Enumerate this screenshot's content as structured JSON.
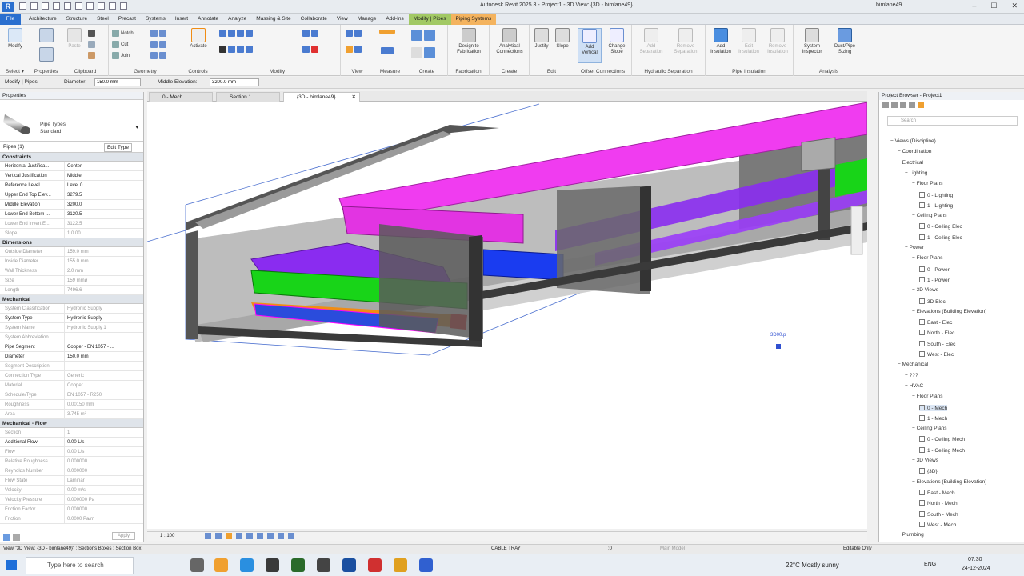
{
  "window": {
    "title": "Autodesk Revit 2025.3 - Project1 - 3D View: {3D - bimlane49}",
    "user": "bimlane49",
    "controls": [
      "–",
      "☐",
      "✕"
    ]
  },
  "menu": {
    "tabs": [
      "File",
      "Architecture",
      "Structure",
      "Steel",
      "Precast",
      "Systems",
      "Insert",
      "Annotate",
      "Analyze",
      "Massing & Site",
      "Collaborate",
      "View",
      "Manage",
      "Add-Ins",
      "Modify | Pipes",
      "Piping Systems"
    ]
  },
  "ribbon": {
    "groups": [
      "Select",
      "Properties",
      "Clipboard",
      "Geometry",
      "Controls",
      "Modify",
      "View",
      "Measure",
      "Create",
      "Fabrication",
      "Create",
      "Edit",
      "Offset Connections",
      "Hydraulic Separation",
      "Pipe Insulation",
      "Analysis"
    ],
    "buttons": {
      "modify": "Modify",
      "paste": "Paste",
      "activate": "Activate",
      "design_to_fab": "Design to Fabrication",
      "analytical": "Analytical Connections",
      "justify": "Justify",
      "slope": "Slope",
      "add_vertical": "Add Vertical",
      "change_slope": "Change Slope",
      "add_sep": "Add Separation",
      "remove_sep": "Remove Separation",
      "add_ins": "Add Insulation",
      "edit_ins": "Edit Insulation",
      "remove_ins": "Remove Insulation",
      "sys_inspector": "System Inspector",
      "duct_sizing": "Duct/Pipe Sizing"
    },
    "small": {
      "notch": "Notch",
      "cut": "Cut",
      "join": "Join"
    },
    "select_label": "Select ▾"
  },
  "options": {
    "context": "Modify | Pipes",
    "diameter_label": "Diameter:",
    "diameter": "150.0 mm",
    "elev_label": "Middle Elevation:",
    "elev": "3200.0 mm"
  },
  "properties": {
    "title": "Properties",
    "type_family": "Pipe Types",
    "type_name": "Standard",
    "instance": "Pipes (1)",
    "edit_type": "Edit Type",
    "sections": [
      {
        "name": "Constraints",
        "rows": [
          [
            "Horizontal Justifica...",
            "Center",
            0
          ],
          [
            "Vertical Justification",
            "Middle",
            0
          ],
          [
            "Reference Level",
            "Level 0",
            0
          ],
          [
            "Upper End Top Elev...",
            "3279.5",
            0
          ],
          [
            "Middle Elevation",
            "3200.0",
            0
          ],
          [
            "Lower End Bottom ...",
            "3120.5",
            0
          ],
          [
            "Lower End Invert El...",
            "3122.5",
            1
          ],
          [
            "Slope",
            "1.0.00",
            1
          ]
        ]
      },
      {
        "name": "Dimensions",
        "rows": [
          [
            "Outside Diameter",
            "159.0 mm",
            1
          ],
          [
            "Inside Diameter",
            "155.0 mm",
            1
          ],
          [
            "Wall Thickness",
            "2.0 mm",
            1
          ],
          [
            "Size",
            "159 mmø",
            1
          ],
          [
            "Length",
            "7496.6",
            1
          ]
        ]
      },
      {
        "name": "Mechanical",
        "rows": [
          [
            "System Classification",
            "Hydronic Supply",
            1
          ],
          [
            "System Type",
            "Hydronic Supply",
            0
          ],
          [
            "System Name",
            "Hydronic Supply 1",
            1
          ],
          [
            "System Abbreviation",
            "",
            1
          ],
          [
            "Pipe Segment",
            "Copper - EN 1057 - ...",
            0
          ],
          [
            "Diameter",
            "150.0 mm",
            0
          ],
          [
            "Segment Description",
            "",
            1
          ],
          [
            "Connection Type",
            "Generic",
            1
          ],
          [
            "Material",
            "Copper",
            1
          ],
          [
            "Schedule/Type",
            "EN 1057 - R250",
            1
          ],
          [
            "Roughness",
            "0.00150 mm",
            1
          ],
          [
            "Area",
            "3.745 m²",
            1
          ]
        ]
      },
      {
        "name": "Mechanical - Flow",
        "rows": [
          [
            "Section",
            "1",
            1
          ],
          [
            "Additional Flow",
            "0.00 L/s",
            0
          ],
          [
            "Flow",
            "0.00 L/s",
            1
          ],
          [
            "Relative Roughness",
            "0.000000",
            1
          ],
          [
            "Reynolds Number",
            "0.000000",
            1
          ],
          [
            "Flow State",
            "Laminar",
            1
          ],
          [
            "Velocity",
            "0.00 m/s",
            1
          ],
          [
            "Velocity Pressure",
            "0.000000 Pa",
            1
          ],
          [
            "Friction Factor",
            "0.000000",
            1
          ],
          [
            "Friction",
            "0.0000 Pa/m",
            1
          ]
        ]
      }
    ],
    "apply": "Apply"
  },
  "tabs": [
    {
      "label": "0 - Mech",
      "active": false
    },
    {
      "label": "Section 1",
      "active": false
    },
    {
      "label": "{3D - bimlane49}",
      "active": true
    }
  ],
  "viewport": {
    "tag": "3D00.p",
    "viewbar_scale": "1 : 100"
  },
  "browser": {
    "title": "Project Browser - Project1",
    "search": "Search",
    "nodes": [
      [
        "Views (Discipline)",
        0,
        0,
        0
      ],
      [
        "Coordination",
        1,
        0,
        0
      ],
      [
        "Electrical",
        1,
        0,
        0
      ],
      [
        "Lighting",
        2,
        0,
        0
      ],
      [
        "Floor Plans",
        3,
        0,
        0
      ],
      [
        "0 - Lighting",
        4,
        1,
        0
      ],
      [
        "1 - Lighting",
        4,
        1,
        0
      ],
      [
        "Ceiling Plans",
        3,
        0,
        0
      ],
      [
        "0 - Ceiling Elec",
        4,
        1,
        0
      ],
      [
        "1 - Ceiling Elec",
        4,
        1,
        0
      ],
      [
        "Power",
        2,
        0,
        0
      ],
      [
        "Floor Plans",
        3,
        0,
        0
      ],
      [
        "0 - Power",
        4,
        1,
        0
      ],
      [
        "1 - Power",
        4,
        1,
        0
      ],
      [
        "3D Views",
        3,
        0,
        0
      ],
      [
        "3D Elec",
        4,
        1,
        0
      ],
      [
        "Elevations (Building Elevation)",
        3,
        0,
        0
      ],
      [
        "East - Elec",
        4,
        1,
        0
      ],
      [
        "North - Elec",
        4,
        1,
        0
      ],
      [
        "South - Elec",
        4,
        1,
        0
      ],
      [
        "West - Elec",
        4,
        1,
        0
      ],
      [
        "Mechanical",
        1,
        0,
        0
      ],
      [
        "???",
        2,
        0,
        0
      ],
      [
        "HVAC",
        2,
        0,
        0
      ],
      [
        "Floor Plans",
        3,
        0,
        0
      ],
      [
        "0 - Mech",
        4,
        1,
        1
      ],
      [
        "1 - Mech",
        4,
        1,
        0
      ],
      [
        "Ceiling Plans",
        3,
        0,
        0
      ],
      [
        "0 - Ceiling Mech",
        4,
        1,
        0
      ],
      [
        "1 - Ceiling Mech",
        4,
        1,
        0
      ],
      [
        "3D Views",
        3,
        0,
        0
      ],
      [
        "{3D}",
        4,
        1,
        0
      ],
      [
        "Elevations (Building Elevation)",
        3,
        0,
        0
      ],
      [
        "East - Mech",
        4,
        1,
        0
      ],
      [
        "North - Mech",
        4,
        1,
        0
      ],
      [
        "South - Mech",
        4,
        1,
        0
      ],
      [
        "West - Mech",
        4,
        1,
        0
      ],
      [
        "Plumbing",
        1,
        0,
        0
      ]
    ]
  },
  "status": {
    "left": "View \"3D View: {3D - bimlane49}\" : Sections Boxes : Section Box",
    "mid": "CABLE TRAY",
    "zero": ":0",
    "model": "Main Model",
    "editable": "Editable Only"
  },
  "taskbar": {
    "search": "Type here to search",
    "weather": "22°C  Mostly sunny",
    "lang": "ENG",
    "time": "07:30",
    "date": "24-12-2024"
  },
  "colors": {
    "magenta": "#f03cf0",
    "purple": "#8a2cf0",
    "green": "#18d418",
    "blue": "#1a3cf0",
    "orange": "#f08c14",
    "red": "#f01414",
    "accent": "#2a6fcf"
  }
}
